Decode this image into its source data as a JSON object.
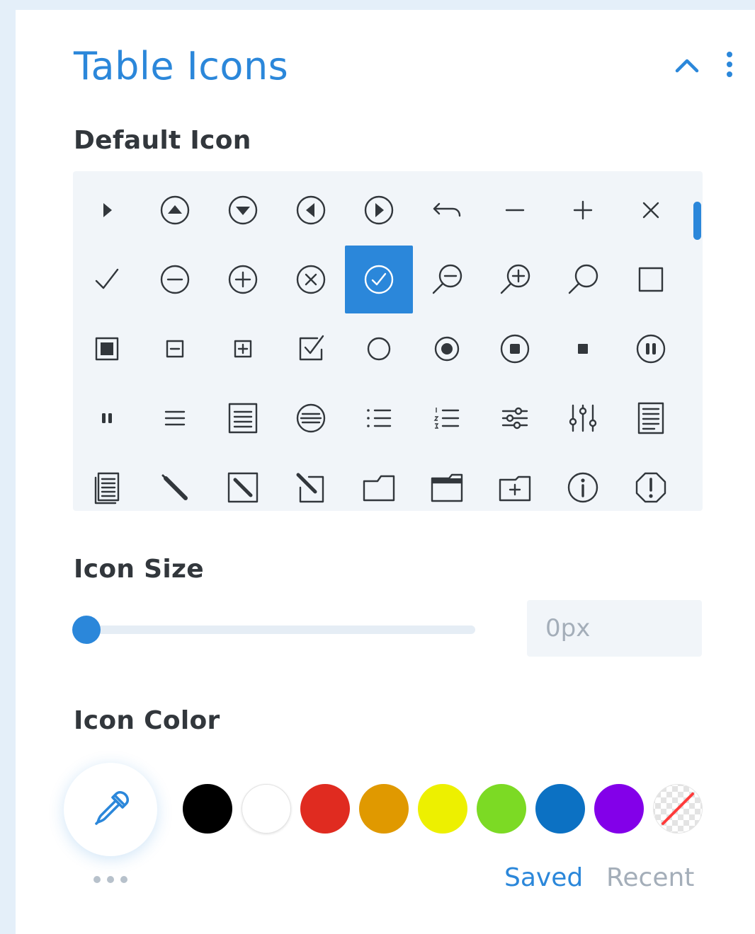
{
  "header": {
    "title": "Table Icons",
    "collapse_icon": "chevron-up-icon",
    "more_icon": "vertical-dots-icon"
  },
  "default_icon": {
    "label": "Default Icon",
    "selected_index": 13,
    "icons": [
      "triangle-right",
      "circle-arrow-up",
      "circle-arrow-down",
      "circle-arrow-left",
      "circle-arrow-right",
      "undo",
      "minus",
      "plus",
      "close",
      "check",
      "circle-minus",
      "circle-plus",
      "circle-x",
      "circle-check",
      "zoom-out",
      "zoom-in",
      "search",
      "square",
      "square-filled-inner",
      "square-minus",
      "square-plus",
      "square-check",
      "circle",
      "radio-checked",
      "circle-stop",
      "small-square",
      "circle-pause",
      "pause",
      "menu-lines",
      "doc-lines",
      "circle-lines",
      "bullet-list",
      "numbered-list",
      "sliders-horizontal",
      "sliders-vertical",
      "doc-text",
      "docs-stack",
      "pencil",
      "square-pencil",
      "square-pencil-corner",
      "folder",
      "folder-open",
      "folder-plus",
      "circle-info",
      "octagon-exclamation"
    ]
  },
  "icon_size": {
    "label": "Icon Size",
    "value": "0px",
    "slider_fraction": 0
  },
  "icon_color": {
    "label": "Icon Color",
    "eyedropper_icon": "eyedropper-icon",
    "swatches": [
      {
        "name": "black",
        "color": "#000000"
      },
      {
        "name": "white",
        "color": "#ffffff"
      },
      {
        "name": "red",
        "color": "#e02b20"
      },
      {
        "name": "orange",
        "color": "#e09900"
      },
      {
        "name": "yellow",
        "color": "#edf000"
      },
      {
        "name": "green",
        "color": "#7cda24"
      },
      {
        "name": "blue",
        "color": "#0c71c3"
      },
      {
        "name": "purple",
        "color": "#8300e9"
      },
      {
        "name": "transparent",
        "color": "transparent"
      }
    ],
    "tabs": {
      "saved": "Saved",
      "recent": "Recent"
    }
  },
  "colors": {
    "accent": "#2b87da",
    "label": "#32373c",
    "muted": "#a4aeb9",
    "grid_bg": "#f1f5f9",
    "icon_stroke": "#32373c"
  }
}
